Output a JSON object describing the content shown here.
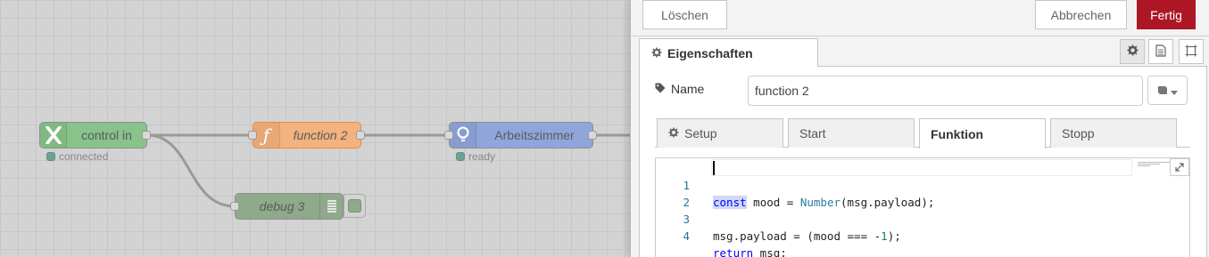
{
  "workspace": {
    "nodes": {
      "control_in": {
        "label": "control in",
        "status": "connected",
        "color": "#87c38a"
      },
      "function2": {
        "label": "function 2",
        "color": "#f3b27e"
      },
      "arbeitszimmer": {
        "label": "Arbeitszimmer",
        "status": "ready",
        "color": "#8fa6dc"
      },
      "debug3": {
        "label": "debug 3",
        "color": "#8fa98b"
      }
    }
  },
  "tray": {
    "buttons": {
      "delete": "Löschen",
      "cancel": "Abbrechen",
      "done": "Fertig"
    },
    "properties_tab": "Eigenschaften",
    "name_label": "Name",
    "name_value": "function 2",
    "subtabs": [
      "Setup",
      "Start",
      "Funktion",
      "Stopp"
    ],
    "active_subtab": "Funktion",
    "code_lines": [
      {
        "n": "1",
        "text": "const mood = Number(msg.payload);"
      },
      {
        "n": "2",
        "text": ""
      },
      {
        "n": "3",
        "text": "msg.payload = (mood === -1);"
      },
      {
        "n": "4",
        "text": "return msg;"
      }
    ]
  },
  "colors": {
    "accent": "#ad1625"
  },
  "icons": {
    "gear": "gear-icon",
    "book": "book-icon",
    "frame": "frame-icon",
    "tag": "tag-icon",
    "caret": "caret-down-icon",
    "expand": "expand-icon"
  }
}
